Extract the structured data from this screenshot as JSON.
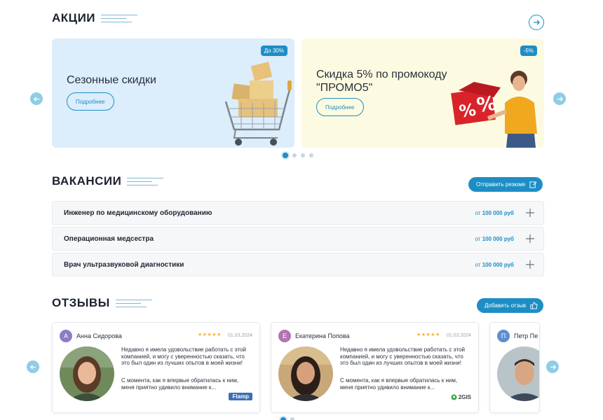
{
  "promotions": {
    "title": "АКЦИИ",
    "cards": [
      {
        "title": "Сезонные скидки",
        "badge": "До 30%",
        "button": "Подробнее"
      },
      {
        "title_line1": "Скидка 5% по промокоду",
        "title_line2": "\"ПРОМО5\"",
        "badge": "-5%",
        "button": "Подробнее"
      }
    ],
    "slides_count": 4,
    "active_slide": 1
  },
  "vacancies": {
    "title": "ВАКАНСИИ",
    "send_button": "Отправить резюме",
    "items": [
      {
        "title": "Инженер по медицинскому оборудованию",
        "salary_prefix": "от",
        "salary": "100 000 руб"
      },
      {
        "title": "Операционная медсестра",
        "salary_prefix": "от",
        "salary": "100 000 руб"
      },
      {
        "title": "Врач ультразвуковой диагностики",
        "salary_prefix": "от",
        "salary": "100 000 руб"
      }
    ]
  },
  "reviews": {
    "title": "ОТЗЫВЫ",
    "add_button": "Добавить отзыв",
    "items": [
      {
        "initial": "А",
        "name": "Анна Сидорова",
        "stars": "★★★★★",
        "date": "01.03.2024",
        "text1": "Недавно я имела удовольствие работать с этой компанией, и могу с уверенностью сказать, что это был один из лучших опытов в моей жизни!",
        "text2": "С момента, как я впервые обратилась к ним, меня приятно удивило внимание к...",
        "source": "Flamp",
        "avatar_color": "#8c7cc7"
      },
      {
        "initial": "Е",
        "name": "Екатерина Попова",
        "stars": "★★★★★",
        "date": "01.03.2024",
        "text1": "Недавно я имела удовольствие работать с этой компанией, и могу с уверенностью сказать, что это был один из лучших опытов в моей жизни!",
        "text2": "С момента, как я впервые обратилась к ним, меня приятно удивило внимание к...",
        "source": "2GIS",
        "avatar_color": "#b472b3"
      },
      {
        "initial": "П",
        "name": "Петр Пе",
        "avatar_color": "#5c8fd0"
      }
    ]
  },
  "colors": {
    "accent": "#1d8ec5",
    "promo_blue": "#dcedfb",
    "promo_yellow": "#fcfbe2"
  }
}
